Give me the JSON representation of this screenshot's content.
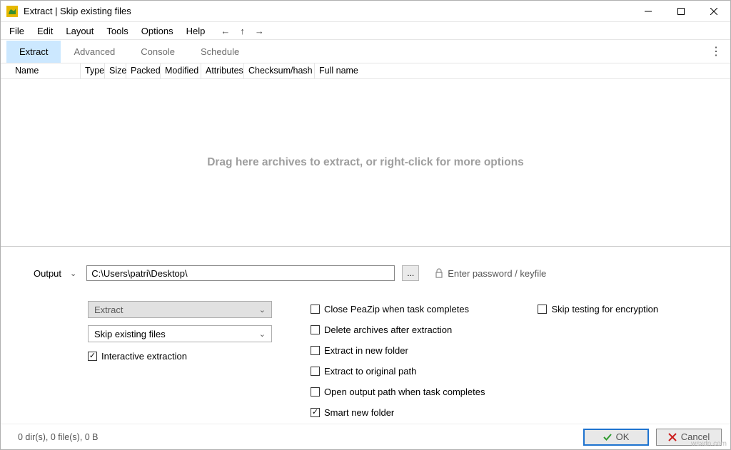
{
  "window": {
    "title": "Extract | Skip existing files"
  },
  "menubar": [
    "File",
    "Edit",
    "Layout",
    "Tools",
    "Options",
    "Help"
  ],
  "tabs": [
    "Extract",
    "Advanced",
    "Console",
    "Schedule"
  ],
  "columns": {
    "name": "Name",
    "type": "Type",
    "size": "Size",
    "packed": "Packed",
    "modified": "Modified",
    "attributes": "Attributes",
    "checksum": "Checksum/hash",
    "fullname": "Full name"
  },
  "drop_hint": "Drag here archives to extract, or right-click for more options",
  "output": {
    "label": "Output",
    "path": "C:\\Users\\patri\\Desktop\\",
    "browse": "...",
    "password_link": "Enter password / keyfile"
  },
  "controls": {
    "action_combo": "Extract",
    "mode_combo": "Skip existing files",
    "interactive": "Interactive extraction"
  },
  "checks": {
    "close": "Close PeaZip when task completes",
    "delete": "Delete archives after extraction",
    "newfolder": "Extract in new folder",
    "original": "Extract to original path",
    "openoutput": "Open output path when task completes",
    "smart": "Smart new folder",
    "skiptest": "Skip testing for encryption"
  },
  "footer": {
    "status": "0 dir(s), 0 file(s), 0 B",
    "ok": "OK",
    "cancel": "Cancel"
  },
  "watermark": "wsxdn.com"
}
